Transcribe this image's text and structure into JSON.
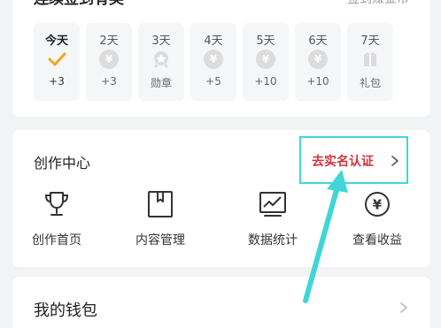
{
  "signin": {
    "title": "连续签到有奖",
    "more": "签到赚金币",
    "days": [
      {
        "label": "今天",
        "reward": "+3",
        "icon": "check-icon"
      },
      {
        "label": "2天",
        "reward": "+3",
        "icon": "coin-icon"
      },
      {
        "label": "3天",
        "reward": "勋章",
        "icon": "badge-icon"
      },
      {
        "label": "4天",
        "reward": "+5",
        "icon": "coin-icon"
      },
      {
        "label": "5天",
        "reward": "+10",
        "icon": "coin-icon"
      },
      {
        "label": "6天",
        "reward": "+10",
        "icon": "coin-icon"
      },
      {
        "label": "7天",
        "reward": "礼包",
        "icon": "gift-icon"
      }
    ],
    "coin_symbol": "¥"
  },
  "create_center": {
    "title": "创作中心",
    "verify_label": "去实名认证",
    "tools": [
      {
        "label": "创作首页",
        "icon": "trophy-icon"
      },
      {
        "label": "内容管理",
        "icon": "bookmark-icon"
      },
      {
        "label": "数据统计",
        "icon": "chart-icon"
      },
      {
        "label": "查看收益",
        "icon": "yuan-icon"
      }
    ],
    "yuan_symbol": "¥"
  },
  "wallet": {
    "title": "我的钱包"
  },
  "colors": {
    "accent_check": "#f5a623",
    "verify_text": "#d8323c",
    "highlight": "#40d6d8"
  }
}
